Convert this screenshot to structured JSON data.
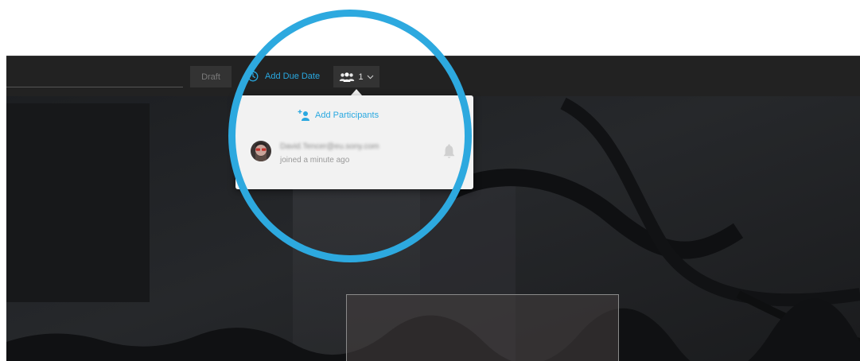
{
  "toolbar": {
    "draft_label": "Draft",
    "due_date_label": "Add Due Date",
    "participant_count": "1",
    "icons": {
      "clock": "clock-icon",
      "participants": "participants-icon",
      "dropdown": "chevron-down-icon"
    }
  },
  "participants_popover": {
    "add_label": "Add Participants",
    "add_icon": "add-participant-icon",
    "participants": [
      {
        "email": "David.Tencer@eu.sony.com",
        "status": "joined a minute ago",
        "notification_icon": "bell-icon"
      }
    ]
  },
  "colors": {
    "accent": "#29a8e0",
    "highlight_ring": "#2da9df",
    "toolbar_bg": "#222222",
    "popover_bg": "#f2f2f2",
    "button_bg": "#333333"
  }
}
